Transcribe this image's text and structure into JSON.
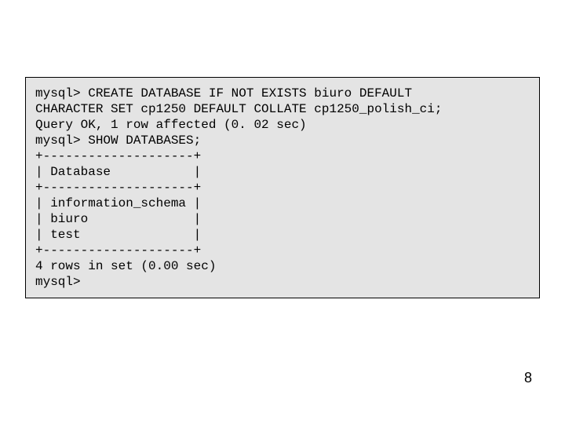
{
  "terminal": {
    "lines": [
      "mysql> CREATE DATABASE IF NOT EXISTS biuro DEFAULT",
      "CHARACTER SET cp1250 DEFAULT COLLATE cp1250_polish_ci;",
      "Query OK, 1 row affected (0. 02 sec)",
      "",
      "mysql> SHOW DATABASES;",
      "+--------------------+",
      "| Database           |",
      "+--------------------+",
      "| information_schema |",
      "| biuro              |",
      "| test               |",
      "+--------------------+",
      "4 rows in set (0.00 sec)",
      "mysql>"
    ]
  },
  "page_number": "8"
}
